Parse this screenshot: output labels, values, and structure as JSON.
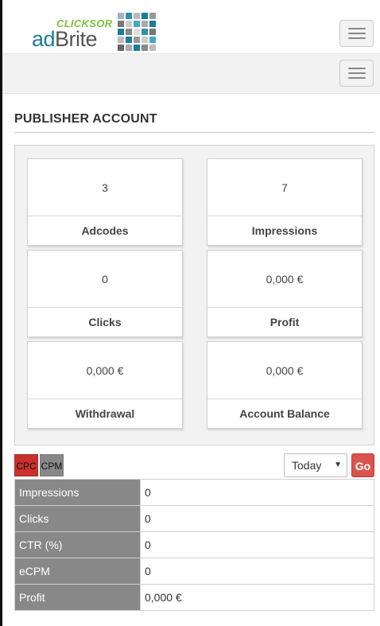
{
  "header": {
    "logo_top": "CLICKSOR",
    "logo_main_1": "ad",
    "logo_main_2": "Brite"
  },
  "page_title": "PUBLISHER ACCOUNT",
  "stats": [
    {
      "value": "3",
      "label": "Adcodes"
    },
    {
      "value": "7",
      "label": "Impressions"
    },
    {
      "value": "0",
      "label": "Clicks"
    },
    {
      "value": "0,000 €",
      "label": "Profit"
    },
    {
      "value": "0,000 €",
      "label": "Withdrawal"
    },
    {
      "value": "0,000 €",
      "label": "Account Balance"
    }
  ],
  "mode_tabs": {
    "cpc": "CPC",
    "cpm": "CPM"
  },
  "period": {
    "selected": "Today",
    "go": "Go"
  },
  "table": [
    {
      "key": "Impressions",
      "value": "0"
    },
    {
      "key": "Clicks",
      "value": "0"
    },
    {
      "key": "CTR (%)",
      "value": "0"
    },
    {
      "key": "eCPM",
      "value": "0"
    },
    {
      "key": "Profit",
      "value": "0,000 €"
    }
  ],
  "colors": {
    "cpc_active": "#c9302c",
    "cpm": "#888888",
    "go": "#d9534f",
    "logo_blue": "#1a7c9a",
    "logo_green": "#7cc142"
  },
  "icons": {
    "menu": "hamburger-icon",
    "select": "chevron-down-icon"
  }
}
